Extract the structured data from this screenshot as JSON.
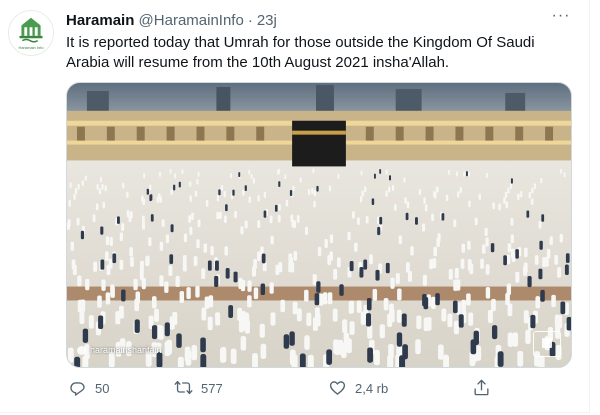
{
  "tweet": {
    "author": {
      "name": "Haramain",
      "handle": "@HaramainInfo",
      "time": "23j",
      "avatar_caption": "Haramain Info"
    },
    "text": "It is reported today that Umrah for those outside the Kingdom Of Saudi Arabia will resume from the 10th August 2021 insha'Allah.",
    "media": {
      "watermark": "haramainsharifain"
    },
    "actions": {
      "reply": {
        "icon": "reply-icon",
        "count": "50"
      },
      "retweet": {
        "icon": "retweet-icon",
        "count": "577"
      },
      "like": {
        "icon": "heart-icon",
        "count": "2,4 rb"
      },
      "share": {
        "icon": "share-icon"
      }
    },
    "colors": {
      "text": "#0f1419",
      "secondary": "#536471",
      "border": "#cfd9de",
      "avatar_green": "#4a9b4f"
    }
  }
}
